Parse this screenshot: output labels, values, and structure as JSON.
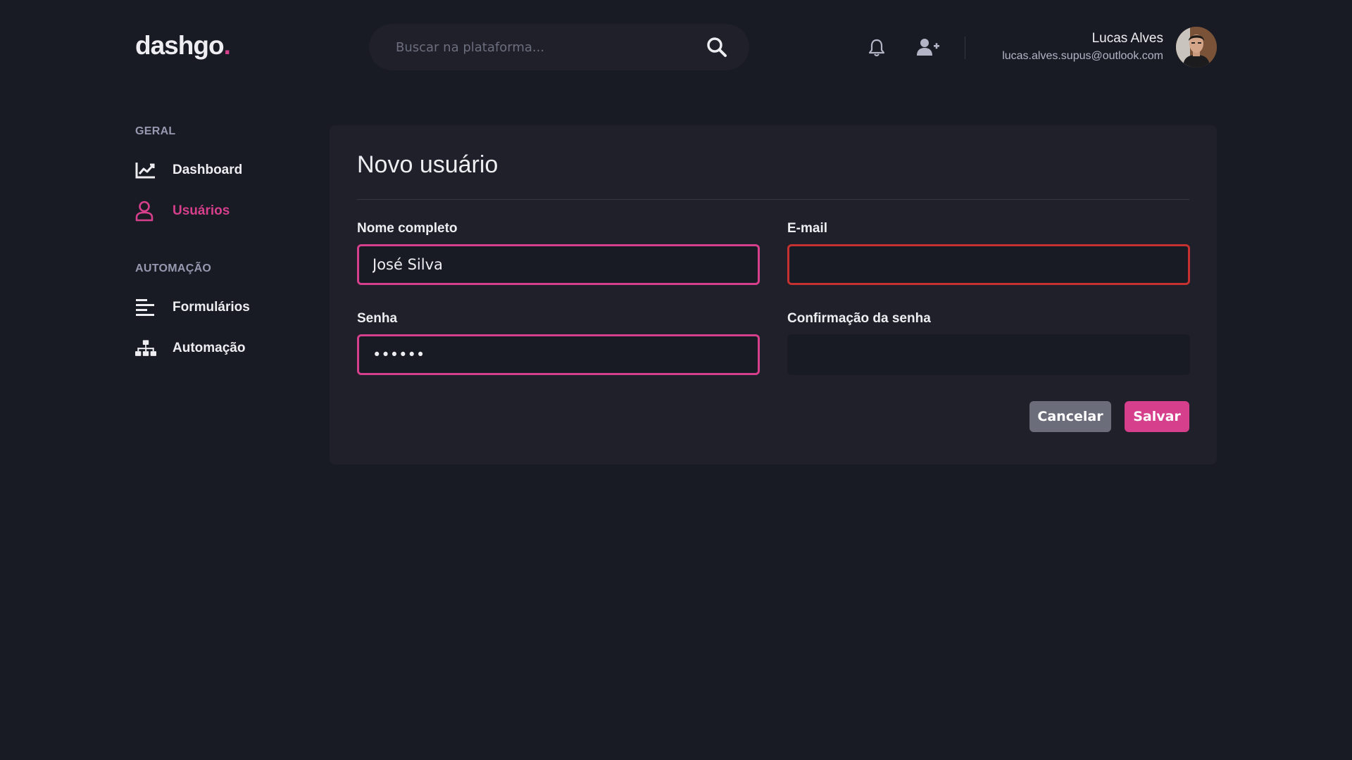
{
  "header": {
    "logo_text": "dashgo",
    "logo_dot": ".",
    "search_placeholder": "Buscar na plataforma...",
    "user_name": "Lucas Alves",
    "user_email": "lucas.alves.supus@outlook.com"
  },
  "sidebar": {
    "sections": [
      {
        "title": "GERAL",
        "items": [
          {
            "label": "Dashboard",
            "icon": "chart-line-icon"
          },
          {
            "label": "Usuários",
            "icon": "user-icon",
            "active": true
          }
        ]
      },
      {
        "title": "AUTOMAÇÃO",
        "items": [
          {
            "label": "Formulários",
            "icon": "align-left-icon"
          },
          {
            "label": "Automação",
            "icon": "sitemap-icon"
          }
        ]
      }
    ]
  },
  "form": {
    "title": "Novo usuário",
    "fields": {
      "name": {
        "label": "Nome completo",
        "value": "José Silva",
        "state": "focus"
      },
      "email": {
        "label": "E-mail",
        "value": "",
        "state": "error"
      },
      "password": {
        "label": "Senha",
        "value": "••••••",
        "state": "focus"
      },
      "password_confirmation": {
        "label": "Confirmação da senha",
        "value": "",
        "state": "default"
      }
    },
    "cancel_label": "Cancelar",
    "save_label": "Salvar"
  },
  "colors": {
    "background": "#181b23",
    "surface": "#1f2029",
    "accent": "#d53f8c",
    "error": "#c53030",
    "muted": "#9699b0"
  }
}
